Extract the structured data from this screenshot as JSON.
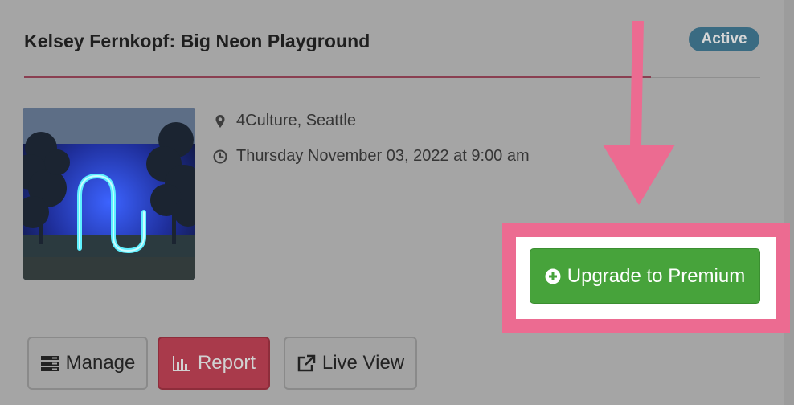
{
  "event": {
    "title": "Kelsey Fernkopf: Big Neon Playground",
    "status": "Active",
    "location": "4Culture, Seattle",
    "datetime": "Thursday November 03, 2022 at 9:00 am",
    "image_alt": "Neon sculpture thumbnail"
  },
  "actions": {
    "manage_label": "Manage",
    "report_label": "Report",
    "live_view_label": "Live View",
    "upgrade_label": "Upgrade to Premium"
  },
  "icons": {
    "location": "map-pin-icon",
    "date": "clock-icon",
    "manage": "server-icon",
    "report": "bar-chart-icon",
    "live_view": "external-link-icon",
    "upgrade": "plus-circle-icon"
  },
  "colors": {
    "badge": "#3a6b82",
    "report_button": "#a93a4b",
    "upgrade_button": "#47a33b",
    "highlight": "#ec6b91"
  }
}
